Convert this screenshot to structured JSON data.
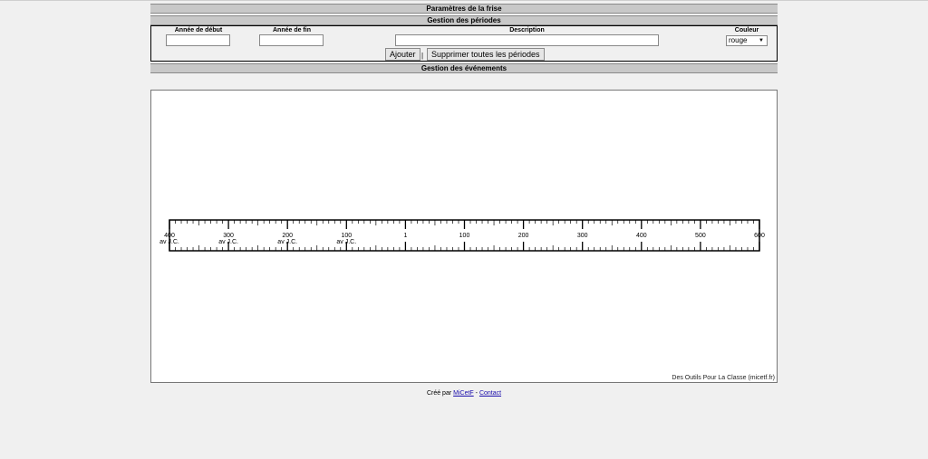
{
  "sections": {
    "parametres": "Paramètres de la frise",
    "periodes": "Gestion des périodes",
    "evenements": "Gestion des événements"
  },
  "form": {
    "start_label": "Année de début",
    "end_label": "Année de fin",
    "description_label": "Description",
    "color_label": "Couleur",
    "start_value": "",
    "end_value": "",
    "description_value": "",
    "color_selected": "rouge",
    "add_button": "Ajouter",
    "separator": "|",
    "delete_all_button": "Supprimer toutes les périodes"
  },
  "timeline": {
    "ticks": [
      {
        "value": -400,
        "label": "400",
        "sub": "av J.C."
      },
      {
        "value": -300,
        "label": "300",
        "sub": "av J.C."
      },
      {
        "value": -200,
        "label": "200",
        "sub": "av J.C."
      },
      {
        "value": -100,
        "label": "100",
        "sub": "av J.C."
      },
      {
        "value": 1,
        "label": "1",
        "sub": ""
      },
      {
        "value": 100,
        "label": "100",
        "sub": ""
      },
      {
        "value": 200,
        "label": "200",
        "sub": ""
      },
      {
        "value": 300,
        "label": "300",
        "sub": ""
      },
      {
        "value": 400,
        "label": "400",
        "sub": ""
      },
      {
        "value": 500,
        "label": "500",
        "sub": ""
      },
      {
        "value": 600,
        "label": "600",
        "sub": ""
      }
    ],
    "minor_step": 10,
    "credit": "Des Outils Pour La Classe (micetf.fr)"
  },
  "footer": {
    "prefix": "Créé par",
    "author_link": "MiCetF",
    "dash": "-",
    "contact_link": "Contact"
  },
  "colors": {
    "bar_bg": "#c8c8c8",
    "page_bg": "#f0f0f0",
    "link": "#1a0dab"
  }
}
